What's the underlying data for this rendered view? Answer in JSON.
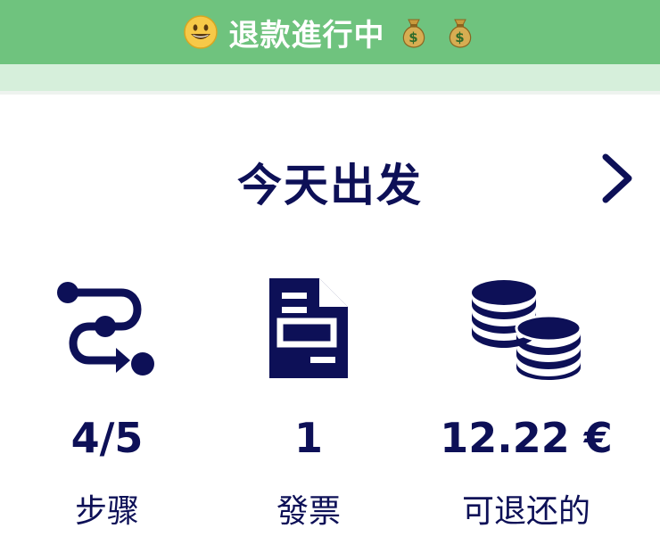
{
  "banner": {
    "text": "退款進行中",
    "leading_emoji_icon": "grinning-face-icon",
    "trailing_emoji_icons": [
      "money-bag-icon",
      "money-bag-icon"
    ],
    "background_color": "#6fc37e"
  },
  "header": {
    "title": "今天出发",
    "chevron_icon": "chevron-right-icon"
  },
  "stats": [
    {
      "icon": "route-steps-icon",
      "value": "4/5",
      "label": "步骤"
    },
    {
      "icon": "invoice-document-icon",
      "value": "1",
      "label": "發票"
    },
    {
      "icon": "coin-stack-icon",
      "value": "12.22 €",
      "label": "可退还的"
    }
  ],
  "colors": {
    "text_primary": "#0d1057",
    "banner_green": "#6fc37e",
    "banner_light": "#d6efdb"
  }
}
